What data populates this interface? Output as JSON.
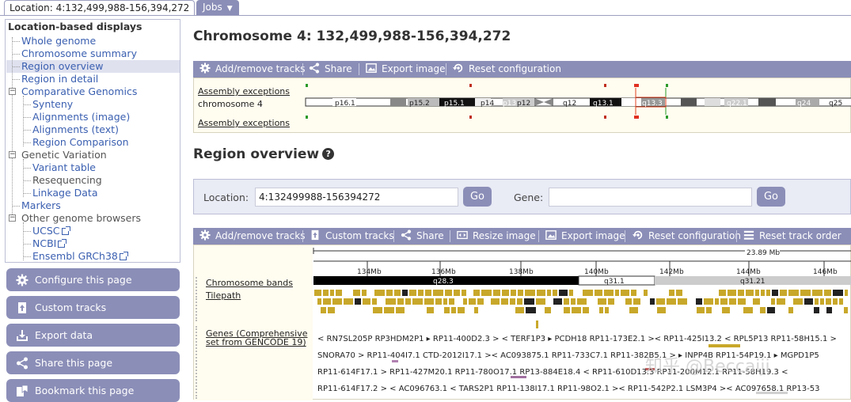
{
  "tabs": {
    "location": "Location: 4:132,499,988-156,394,272",
    "jobs": "Jobs"
  },
  "nav": {
    "header": "Location-based displays",
    "items": [
      {
        "label": "Whole genome",
        "type": "link"
      },
      {
        "label": "Chromosome summary",
        "type": "link"
      },
      {
        "label": "Region overview",
        "type": "active"
      },
      {
        "label": "Region in detail",
        "type": "link"
      },
      {
        "label": "Comparative Genomics",
        "type": "group"
      },
      {
        "label": "Synteny",
        "type": "link"
      },
      {
        "label": "Alignments (image)",
        "type": "link"
      },
      {
        "label": "Alignments (text)",
        "type": "link"
      },
      {
        "label": "Region Comparison",
        "type": "link"
      },
      {
        "label": "Genetic Variation",
        "type": "group-text"
      },
      {
        "label": "Variant table",
        "type": "link"
      },
      {
        "label": "Resequencing",
        "type": "text"
      },
      {
        "label": "Linkage Data",
        "type": "link"
      },
      {
        "label": "Markers",
        "type": "link"
      },
      {
        "label": "Other genome browsers",
        "type": "group-text"
      },
      {
        "label": "UCSC",
        "type": "ext"
      },
      {
        "label": "NCBI",
        "type": "ext"
      },
      {
        "label": "Ensembl GRCh38",
        "type": "ext"
      }
    ]
  },
  "side_buttons": {
    "configure": "Configure this page",
    "custom": "Custom tracks",
    "export": "Export data",
    "share": "Share this page",
    "bookmark": "Bookmark this page"
  },
  "page_title": "Chromosome 4: 132,499,988-156,394,272",
  "toolbar1": {
    "add_remove": "Add/remove tracks",
    "share": "Share",
    "export": "Export image",
    "reset": "Reset configuration"
  },
  "ideogram": {
    "assembly_top": "Assembly exceptions",
    "chromosome": "chromosome 4",
    "assembly_bottom": "Assembly exceptions",
    "bands": [
      "p16.1",
      "p15.2",
      "p15.1",
      "p14",
      "p13",
      "p12",
      "q12",
      "q13.1",
      "q13.3",
      "q22.1",
      "q24",
      "q25"
    ]
  },
  "region_heading": "Region overview",
  "help_icon": "?",
  "search": {
    "location_label": "Location:",
    "location_value": "4:132499988-156394272",
    "go": "Go",
    "gene_label": "Gene:",
    "gene_value": ""
  },
  "toolbar2": {
    "add_remove": "Add/remove tracks",
    "custom": "Custom tracks",
    "share": "Share",
    "resize": "Resize image",
    "export": "Export image",
    "reset": "Reset configuration",
    "reset_order": "Reset track order"
  },
  "region": {
    "length": "23.89 Mb",
    "ticks": [
      "134Mb",
      "136Mb",
      "138Mb",
      "140Mb",
      "142Mb",
      "144Mb",
      "146Mb"
    ],
    "track_bands": "Chromosome bands",
    "track_tilepath": "Tilepath",
    "track_genes": "Genes (Comprehensive set from GENCODE 19)",
    "bands": [
      "q28.3",
      "q31.1",
      "q31.21"
    ],
    "gene_rows": [
      "< RN7SL205P  RP3HDM2P1 ▸ RP11-400D2.3 >  < TERF1P3 ▸ PCDH18  RP11-173E2.1 >< RP11-425I13.2  < RPL5P13  RP11-58H15.1 >",
      "SNORA70 >  RP11-404I7.1  CTD-2012I17.1 >< AC093875.1  RP11-733C7.1  RP11-382B5.1 >  ▸ INPP4B  RP11-54P19.1  ▸ MGPD1P5",
      "RP11-614F17.1 >  RP11-427M20.1  RP11-780O17.1  RP13-884E18.4 < RP11-610D13.3  RP11-200M12.1  RP11-58H19.3 <",
      "RP11-614F17.2 >  < AC096763.1 < TARS2P1  RP11-138I17.1  RP11-98O2.1 >< RP11-542P2.1  LSM3P4 >< AC097658.1  RP13-53"
    ]
  },
  "watermark": "知乎 @Beccaiji",
  "colors": {
    "accent": "#8b8eb7",
    "link": "#3a5fb0",
    "panel_bg": "#fffcf0",
    "gene_gold": "#c8a82a"
  }
}
